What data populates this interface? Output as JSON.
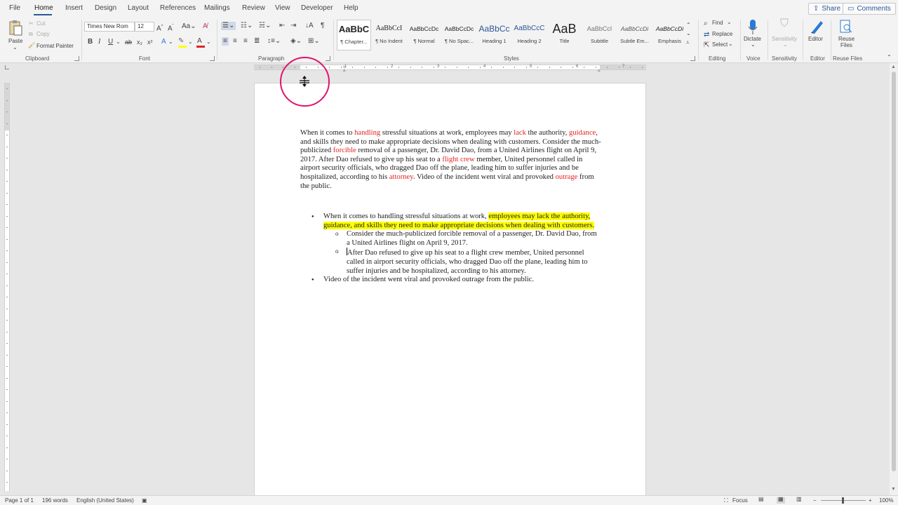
{
  "menu": {
    "tabs": [
      {
        "label": "File"
      },
      {
        "label": "Home"
      },
      {
        "label": "Insert"
      },
      {
        "label": "Design"
      },
      {
        "label": "Layout"
      },
      {
        "label": "References"
      },
      {
        "label": "Mailings"
      },
      {
        "label": "Review"
      },
      {
        "label": "View"
      },
      {
        "label": "Developer"
      },
      {
        "label": "Help"
      }
    ],
    "active_tab": "Home",
    "share_label": "Share",
    "comments_label": "Comments"
  },
  "ribbon": {
    "clipboard": {
      "paste": "Paste",
      "cut": "Cut",
      "copy": "Copy",
      "format_painter": "Format Painter",
      "group_label": "Clipboard"
    },
    "font": {
      "font_name": "Times New Rom",
      "font_size": "12",
      "group_label": "Font",
      "font_color": "#e02424",
      "highlight_color": "#ffff00"
    },
    "paragraph": {
      "group_label": "Paragraph"
    },
    "styles": {
      "group_label": "Styles",
      "items": [
        {
          "sample": "AaBbC",
          "name": "¶ Chapter..."
        },
        {
          "sample": "AaBbCcI",
          "name": "¶ No Indent"
        },
        {
          "sample": "AaBbCcDc",
          "name": "¶ Normal"
        },
        {
          "sample": "AaBbCcDc",
          "name": "¶ No Spac..."
        },
        {
          "sample": "AaBbCc",
          "name": "Heading 1"
        },
        {
          "sample": "AaBbCcC",
          "name": "Heading 2"
        },
        {
          "sample": "AaB",
          "name": "Title"
        },
        {
          "sample": "AaBbCcI",
          "name": "Subtitle"
        },
        {
          "sample": "AaBbCcDi",
          "name": "Subtle Em..."
        },
        {
          "sample": "AaBbCcDi",
          "name": "Emphasis"
        }
      ]
    },
    "editing": {
      "find": "Find",
      "replace": "Replace",
      "select": "Select",
      "group_label": "Editing"
    },
    "voice": {
      "dictate": "Dictate",
      "group_label": "Voice"
    },
    "sensitivity": {
      "button": "Sensitivity",
      "group_label": "Sensitivity"
    },
    "editor": {
      "button": "Editor",
      "group_label": "Editor"
    },
    "reuse": {
      "button_line1": "Reuse",
      "button_line2": "Files",
      "group_label": "Reuse Files"
    }
  },
  "ruler": {
    "labels": [
      "1",
      "2",
      "3",
      "4",
      "5",
      "6",
      "7"
    ]
  },
  "document": {
    "para1": {
      "s1": "When it comes to ",
      "r1": "handling",
      "s2": " stressful situations at work, employees may ",
      "r2": "lack",
      "s3": " the authority, ",
      "r3": "guidance",
      "s4": ", and skills they need to make appropriate decisions when dealing with customers. Consider the much-publicized ",
      "r4": "forcible",
      "s5": " removal of a passenger, Dr. David Dao, from a United Airlines flight on April 9, 2017. After Dao refused to give up his seat to a ",
      "r5": "flight crew",
      "s6": " member, United personnel called in airport security officials, who dragged Dao off the plane, leading him to suffer injuries and be hospitalized, according to his ",
      "r6": "attorney",
      "s7": ". Video of the incident went viral and provoked ",
      "r7": "outrage",
      "s8": " from the public."
    },
    "bullets": {
      "b1_plain": "When it comes to handling stressful situations at work, ",
      "b1_highlight": "employees may lack the authority, guidance, and skills they need to make appropriate decisions when dealing with customers.",
      "sub1": "Consider the much-publicized forcible removal of a passenger, Dr. David Dao, from a United Airlines flight on April 9, 2017.",
      "sub2": "After Dao refused to give up his seat to a flight crew member, United personnel called in airport security officials, who dragged Dao off the plane, leading him to suffer injuries and be hospitalized, according to his attorney.",
      "b2": "Video of the incident went viral and provoked outrage from the public."
    }
  },
  "status": {
    "page": "Page 1 of 1",
    "words": "196 words",
    "language": "English (United States)",
    "focus": "Focus",
    "zoom": "100%",
    "zoom_minus": "−",
    "zoom_plus": "+"
  },
  "colors": {
    "accent": "#2b579a",
    "cursor_ring": "#e0136d"
  }
}
